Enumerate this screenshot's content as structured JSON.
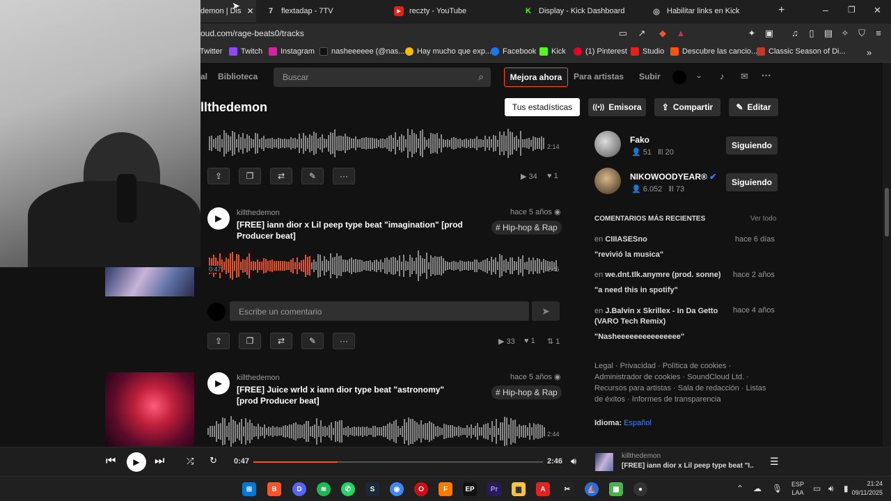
{
  "browser": {
    "tabs": [
      {
        "label": "demon | Dis",
        "active": true
      },
      {
        "label": "flextadap - 7TV"
      },
      {
        "label": "reczty - YouTube"
      },
      {
        "label": "Display - Kick Dashboard"
      },
      {
        "label": "Habilitar links en Kick"
      }
    ],
    "url": "oud.com/rage-beats0/tracks",
    "bookmarks": [
      "Twitter",
      "Twitch",
      "Instagram",
      "nasheeeeee (@nas...",
      "Hay mucho que exp...",
      "Facebook",
      "Kick",
      "(1) Pinterest",
      "Studio",
      "Descubre las cancio...",
      "Classic Season of Di..."
    ]
  },
  "nav": {
    "left_cut": "al",
    "library": "Biblioteca",
    "search_placeholder": "Buscar",
    "upgrade": "Mejora ahora",
    "artists": "Para artistas",
    "upload": "Subir"
  },
  "profile": {
    "name": "llthedemon",
    "stats_btn": "Tus estadísticas",
    "station_btn": "Emisora",
    "share_btn": "Compartir",
    "edit_btn": "Editar"
  },
  "tracks": [
    {
      "wave_time": "2:14",
      "plays": "34",
      "likes": "1"
    },
    {
      "artist": "killthedemon",
      "age": "hace 5 años",
      "title": "[FREE] iann dior x Lil peep type beat \"imagination\" [prod Producer beat]",
      "tag": "# Hip-hop & Rap",
      "elapsed": "0:47",
      "duration": "2:46",
      "plays": "33",
      "likes": "1",
      "reposts": "1",
      "progress": 0.29
    },
    {
      "artist": "killthedemon",
      "age": "hace 5 años",
      "title": "[FREE] Juice wrld x iann dior type beat \"astronomy\" [prod Producer beat]",
      "tag": "# Hip-hop & Rap",
      "duration": "2:44"
    }
  ],
  "comment_placeholder": "Escribe un comentario",
  "following": [
    {
      "name": "Fako",
      "followers": "51",
      "tracks": "20",
      "btn": "Siguiendo"
    },
    {
      "name": "NIKOWOODYEAR®",
      "followers": "6.052",
      "tracks": "73",
      "btn": "Siguiendo"
    }
  ],
  "recent_comments": {
    "heading": "COMENTARIOS MÁS RECIENTES",
    "see_all": "Ver todo",
    "items": [
      {
        "prefix": "en",
        "track": "CIIIASESno",
        "when": "hace 6 días",
        "text": "\"revivió la musica\""
      },
      {
        "prefix": "en",
        "track": "we.dnt.tlk.anymre (prod. sonne)",
        "when": "hace 2 años",
        "text": "\"a need this in spotify\""
      },
      {
        "prefix": "en",
        "track": "J.Balvin x Skrillex - In Da Getto (VARO Tech Remix)",
        "when": "hace 4 años",
        "text": "\"Nasheeeeeeeeeeeeeee\""
      }
    ]
  },
  "footer_links": "Legal · Privacidad · Política de cookies · Administrador de cookies · SoundCloud Ltd. · Recursos para artistas · Sala de redacción · Listas de éxitos · Informes de transparencia",
  "language": {
    "label": "Idioma:",
    "value": "Español"
  },
  "player": {
    "elapsed": "0:47",
    "duration": "2:46",
    "progress": 0.29,
    "artist": "killthedemon",
    "title": "[FREE] iann dior x Lil peep type beat \"I..."
  },
  "taskbar": {
    "lang": "ESP",
    "layout": "LAA",
    "time": "21:24",
    "date": "09/11/2025"
  }
}
